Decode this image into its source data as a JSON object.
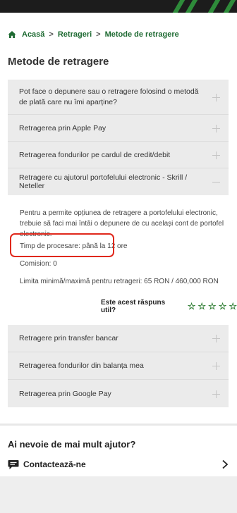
{
  "breadcrumb": {
    "items": [
      "Acasă",
      "Retrageri",
      "Metode de retragere"
    ],
    "separator": ">"
  },
  "page": {
    "title": "Metode de retragere"
  },
  "faq_top": [
    {
      "label": "Pot face o depunere sau o retragere folosind o metodă de plată care nu îmi aparține?",
      "state": "collapsed"
    },
    {
      "label": "Retragerea prin Apple Pay",
      "state": "collapsed"
    },
    {
      "label": "Retragerea fondurilor pe cardul de credit/debit",
      "state": "collapsed"
    },
    {
      "label": "Retragere cu ajutorul portofelului electronic - Skrill / Neteller",
      "state": "expanded"
    }
  ],
  "answer": {
    "intro": "Pentru a permite opțiunea de retragere a portofelului electronic, trebuie să faci mai întâi o depunere de cu același cont de portofel electronic.",
    "processing_time": "Timp de procesare: până la 12 ore",
    "commission": "Comision:  0",
    "limits": "Limita minimă/maximă pentru retrageri: 65 RON / 460,000 RON"
  },
  "rating": {
    "question": "Este acest răspuns util?",
    "max_stars": 5,
    "selected": 0,
    "star_color": "#2e7d32"
  },
  "faq_bottom": [
    {
      "label": "Retragere prin transfer bancar",
      "state": "collapsed"
    },
    {
      "label": "Retragerea fondurilor din balanța mea",
      "state": "collapsed"
    },
    {
      "label": "Retragerea prin Google Pay",
      "state": "collapsed"
    }
  ],
  "help": {
    "title": "Ai nevoie de mai mult ajutor?",
    "contact_label": "Contactează-ne",
    "contact_icon": "chat-bubble-icon",
    "chevron_icon": "chevron-right-icon"
  },
  "colors": {
    "brand_green": "#1f6b33",
    "highlight_red": "#e0281c",
    "panel_gray": "#ebebeb"
  }
}
